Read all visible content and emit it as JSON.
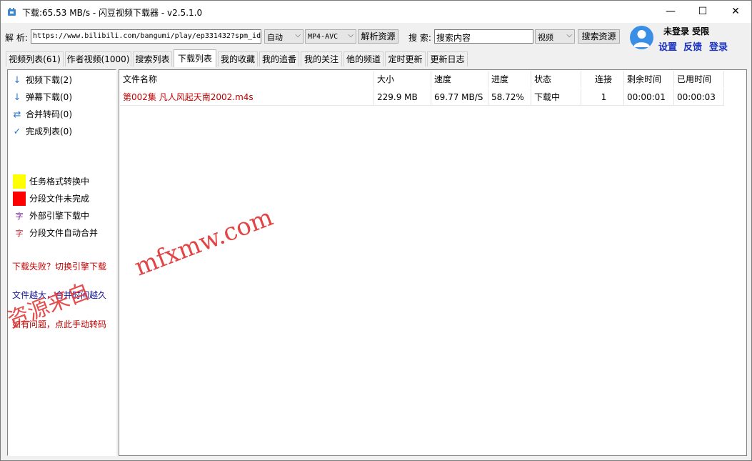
{
  "window": {
    "title": "下载:65.53 MB/s - 闪豆视频下载器 - v2.5.1.0",
    "minimize": "—",
    "maximize": "☐",
    "close": "✕"
  },
  "toolbar": {
    "parse_label": "解 析:",
    "url_value": "https://www.bilibili.com/bangumi/play/ep331432?spm_id",
    "mode_select": "自动",
    "format_select": "MP4-AVC",
    "parse_button": "解析资源",
    "search_label": "搜 索:",
    "search_value": "搜索内容",
    "search_type_select": "视频",
    "search_button": "搜索资源"
  },
  "user": {
    "status": "未登录 受限",
    "settings": "设置",
    "feedback": "反馈",
    "login": "登录"
  },
  "tabs": [
    {
      "label": "视频列表(61)"
    },
    {
      "label": "作者视频(1000)"
    },
    {
      "label": "搜索列表"
    },
    {
      "label": "下载列表"
    },
    {
      "label": "我的收藏"
    },
    {
      "label": "我的追番"
    },
    {
      "label": "我的关注"
    },
    {
      "label": "他的频道"
    },
    {
      "label": "定时更新"
    },
    {
      "label": "更新日志"
    }
  ],
  "sidebar": {
    "items": [
      {
        "label": "视频下载(2)",
        "icon": "↓"
      },
      {
        "label": "弹幕下载(0)",
        "icon": "↓"
      },
      {
        "label": "合并转码(0)",
        "icon": "⇄"
      },
      {
        "label": "完成列表(0)",
        "icon": "✓"
      }
    ],
    "legend": [
      {
        "label": "任务格式转换中",
        "color": "#ffff00"
      },
      {
        "label": "分段文件未完成",
        "color": "#ff0000"
      },
      {
        "label": "外部引擎下载中",
        "glyph": "字",
        "color": "#7a1fa2"
      },
      {
        "label": "分段文件自动合并",
        "glyph": "字",
        "color": "#c0202a"
      }
    ],
    "notes": [
      {
        "text": "下载失败？切换引擎下载",
        "color": "#c00000"
      },
      {
        "text": "文件越大，合并时间越久",
        "color": "#1a1a9c"
      },
      {
        "text": "如有问题，点此手动转码",
        "color": "#c00000"
      }
    ]
  },
  "table": {
    "headers": [
      "文件名称",
      "大小",
      "速度",
      "进度",
      "状态",
      "连接",
      "剩余时间",
      "已用时间"
    ],
    "rows": [
      [
        "第002集 凡人风起天南2002.m4s",
        "229.9 MB",
        "69.77 MB/S",
        "58.72%",
        "下载中",
        "1",
        "00:00:01",
        "00:00:03"
      ]
    ],
    "name_color": "#c00000"
  },
  "watermark": {
    "line1": "mfxmw.com",
    "line2": "资源来自"
  }
}
